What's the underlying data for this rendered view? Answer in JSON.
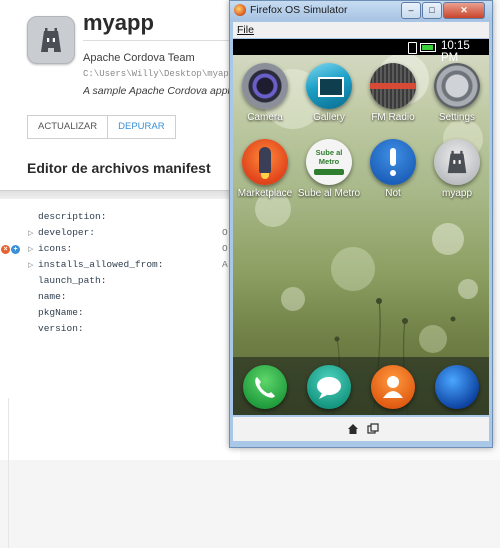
{
  "app_manager": {
    "app": {
      "name": "myapp",
      "developer": "Apache Cordova Team",
      "path": "C:\\Users\\Willy\\Desktop\\myapp",
      "description": "A sample Apache Cordova application"
    },
    "buttons": {
      "update": "ACTUALIZAR",
      "debug": "DEPURAR"
    },
    "manifest": {
      "title": "Editor de archivos manifest",
      "rows": [
        {
          "key": "description:",
          "expandable": false,
          "value": ""
        },
        {
          "key": "developer:",
          "expandable": true,
          "value": "O"
        },
        {
          "key": "icons:",
          "expandable": true,
          "value": "O"
        },
        {
          "key": "installs_allowed_from:",
          "expandable": true,
          "value": "A"
        },
        {
          "key": "launch_path:",
          "expandable": false,
          "value": ""
        },
        {
          "key": "name:",
          "expandable": false,
          "value": ""
        },
        {
          "key": "pkgName:",
          "expandable": false,
          "value": ""
        },
        {
          "key": "version:",
          "expandable": false,
          "value": ""
        }
      ]
    }
  },
  "simulator": {
    "window_title": "Firefox OS Simulator",
    "menu": {
      "file": "File"
    },
    "status": {
      "time": "10:15 PM"
    },
    "apps": [
      {
        "label": "Camera",
        "icon": "camera-icon"
      },
      {
        "label": "Gallery",
        "icon": "gallery-icon"
      },
      {
        "label": "FM Radio",
        "icon": "radio-icon"
      },
      {
        "label": "Settings",
        "icon": "gear-icon"
      },
      {
        "label": "Marketplace",
        "icon": "marketplace-icon"
      },
      {
        "label": "Sube al Metro",
        "icon": "metro-icon",
        "icon_text": "Sube al Metro"
      },
      {
        "label": "Not",
        "icon": "exclamation-icon"
      },
      {
        "label": "myapp",
        "icon": "cordova-robot-icon"
      }
    ],
    "dock": [
      {
        "icon": "phone-icon"
      },
      {
        "icon": "messages-icon"
      },
      {
        "icon": "contacts-icon"
      },
      {
        "icon": "browser-icon"
      }
    ]
  },
  "colors": {
    "accent_blue": "#3a8fd6",
    "remove_orange": "#e8612c",
    "titlebar_blue": "#a9c7e6",
    "battery_green": "#3ad03a"
  }
}
